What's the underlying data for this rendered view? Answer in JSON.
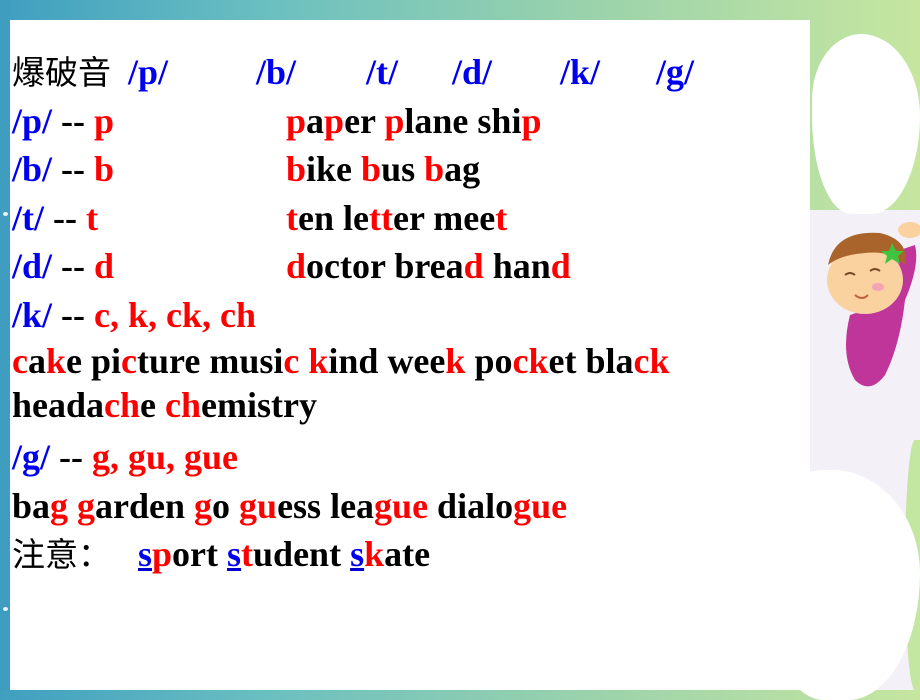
{
  "slide": {
    "header": {
      "label": "爆破音",
      "phonemes": [
        "/p/",
        "/b/",
        "/t/",
        "/d/",
        "/k/",
        "/g/"
      ]
    },
    "rows": [
      {
        "phoneme": "/p/",
        "sep": "--",
        "letters": "p",
        "words": [
          [
            {
              "t": "p",
              "r": true
            },
            {
              "t": "a"
            },
            {
              "t": "p",
              "r": true
            },
            {
              "t": "er"
            }
          ],
          [
            {
              "t": "p",
              "r": true
            },
            {
              "t": "lane"
            }
          ],
          [
            {
              "t": "shi"
            },
            {
              "t": "p",
              "r": true
            }
          ]
        ]
      },
      {
        "phoneme": "/b/",
        "sep": "--",
        "letters": "b",
        "words": [
          [
            {
              "t": "b",
              "r": true
            },
            {
              "t": "ike"
            }
          ],
          [
            {
              "t": "b",
              "r": true
            },
            {
              "t": "us"
            }
          ],
          [
            {
              "t": "b",
              "r": true
            },
            {
              "t": "ag"
            }
          ]
        ]
      },
      {
        "phoneme": "/t/",
        "sep": "--",
        "letters": "t",
        "words": [
          [
            {
              "t": "t",
              "r": true
            },
            {
              "t": "en"
            }
          ],
          [
            {
              "t": "le"
            },
            {
              "t": "tt",
              "r": true
            },
            {
              "t": "er"
            }
          ],
          [
            {
              "t": "mee"
            },
            {
              "t": "t",
              "r": true
            }
          ]
        ]
      },
      {
        "phoneme": "/d/",
        "sep": "--",
        "letters": "d",
        "words": [
          [
            {
              "t": "d",
              "r": true
            },
            {
              "t": "octor"
            }
          ],
          [
            {
              "t": "brea"
            },
            {
              "t": "d",
              "r": true
            }
          ],
          [
            {
              "t": "han"
            },
            {
              "t": "d",
              "r": true
            }
          ]
        ]
      }
    ],
    "k_row": {
      "phoneme": "/k/",
      "sep": "--",
      "letters": "c, k, ck, ch"
    },
    "k_words_line1": [
      [
        {
          "t": "c",
          "r": true
        },
        {
          "t": "a"
        },
        {
          "t": "k",
          "r": true
        },
        {
          "t": "e"
        }
      ],
      [
        {
          "t": "pi"
        },
        {
          "t": "c",
          "r": true
        },
        {
          "t": "ture"
        }
      ],
      [
        {
          "t": "musi"
        },
        {
          "t": "c",
          "r": true
        }
      ],
      [
        {
          "t": "k",
          "r": true
        },
        {
          "t": "ind"
        }
      ],
      [
        {
          "t": "wee"
        },
        {
          "t": "k",
          "r": true
        }
      ],
      [
        {
          "t": "po"
        },
        {
          "t": "ck",
          "r": true
        },
        {
          "t": "et"
        }
      ],
      [
        {
          "t": "bla"
        },
        {
          "t": "ck",
          "r": true
        }
      ]
    ],
    "k_words_line2": [
      [
        {
          "t": "heada"
        },
        {
          "t": "ch",
          "r": true
        },
        {
          "t": "e"
        }
      ],
      [
        {
          "t": "ch",
          "r": true
        },
        {
          "t": "emistry"
        }
      ]
    ],
    "g_row": {
      "phoneme": "/g/",
      "sep": "--",
      "letters": "g, gu, gue"
    },
    "g_words": [
      [
        {
          "t": "ba"
        },
        {
          "t": "g",
          "r": true
        }
      ],
      [
        {
          "t": "g",
          "r": true
        },
        {
          "t": "arden"
        }
      ],
      [
        {
          "t": "g",
          "r": true
        },
        {
          "t": "o"
        }
      ],
      [
        {
          "t": "gu",
          "r": true
        },
        {
          "t": "ess"
        }
      ],
      [
        {
          "t": "lea"
        },
        {
          "t": "gue",
          "r": true
        }
      ],
      [
        {
          "t": "dialo"
        },
        {
          "t": "gue",
          "r": true
        }
      ]
    ],
    "note": {
      "label": "注意：",
      "words": [
        [
          {
            "t": "s",
            "b": true
          },
          {
            "t": "p",
            "r": true
          },
          {
            "t": "ort"
          }
        ],
        [
          {
            "t": "s",
            "b": true
          },
          {
            "t": "t",
            "r": true
          },
          {
            "t": "udent"
          }
        ],
        [
          {
            "t": "s",
            "b": true
          },
          {
            "t": "k",
            "r": true
          },
          {
            "t": "ate"
          }
        ]
      ]
    }
  },
  "colors": {
    "phoneme": "#0000ee",
    "highlight": "#ff0000",
    "text": "#000000",
    "background_left": "#3f9fc0",
    "background_right": "#c6e6a0"
  },
  "decoration": {
    "illustration": "cartoon-girl-on-cloud"
  }
}
